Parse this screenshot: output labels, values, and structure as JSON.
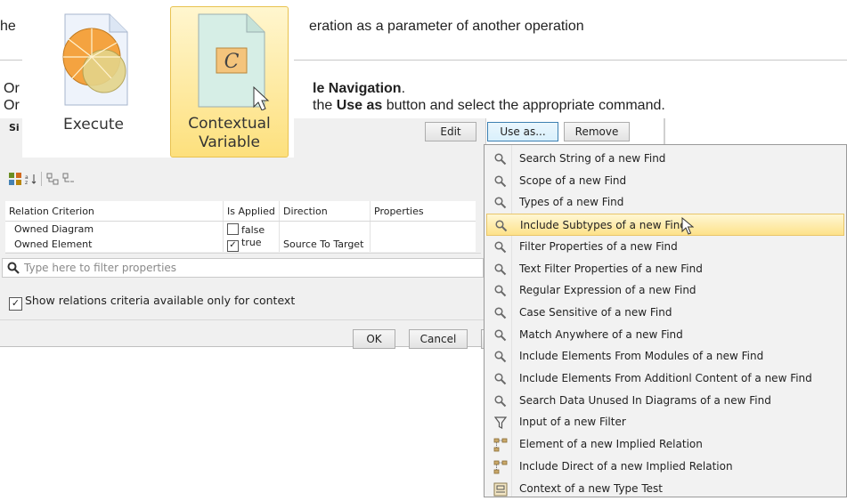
{
  "doc": {
    "line1_a": "he",
    "line1_b": "eration as a parameter of another operation",
    "line2_a": "Or",
    "line2_b": "le Navigation",
    "line2_c": ".",
    "line3_a": "Or",
    "line3_b": "the ",
    "line3_c": "Use as",
    "line3_d": " button and select the appropriate command."
  },
  "big_icons": [
    {
      "label": "Execute",
      "icon": "execute-icon"
    },
    {
      "label_line1": "Contextual",
      "label_line2": "Variable",
      "icon": "contextual-variable-icon",
      "glyph": "C"
    }
  ],
  "dialog": {
    "title_fragment": "Si",
    "buttons": {
      "edit": "Edit",
      "use_as": "Use as...",
      "remove": "Remove",
      "ok": "OK",
      "cancel": "Cancel"
    },
    "table": {
      "headers": [
        "Relation Criterion",
        "Is Applied",
        "Direction",
        "Properties"
      ],
      "rows": [
        {
          "criterion": "Owned Diagram",
          "applied": "false",
          "checked": false,
          "direction": "",
          "properties": ""
        },
        {
          "criterion": "Owned Element",
          "applied": "true",
          "checked": true,
          "direction": "Source To Target",
          "properties": ""
        }
      ]
    },
    "filter_placeholder": "Type here to filter properties",
    "show_relations_label": "Show relations criteria available only for context",
    "show_relations_checked": true
  },
  "menu": {
    "items": [
      {
        "label": "Search String of a new Find",
        "icon": "search-icon"
      },
      {
        "label": "Scope of a new Find",
        "icon": "search-icon"
      },
      {
        "label": "Types of a new Find",
        "icon": "search-icon"
      },
      {
        "label": "Include Subtypes of a new Find",
        "icon": "search-icon",
        "highlighted": true
      },
      {
        "label": "Filter Properties of a new Find",
        "icon": "search-icon"
      },
      {
        "label": "Text Filter Properties of a new Find",
        "icon": "search-icon"
      },
      {
        "label": "Regular Expression of a new Find",
        "icon": "search-icon"
      },
      {
        "label": "Case Sensitive of a new Find",
        "icon": "search-icon"
      },
      {
        "label": "Match Anywhere of a new Find",
        "icon": "search-icon"
      },
      {
        "label": "Include Elements From Modules of a new Find",
        "icon": "search-icon"
      },
      {
        "label": "Include Elements From Additionl Content of a new Find",
        "icon": "search-icon"
      },
      {
        "label": "Search Data Unused In Diagrams of a new Find",
        "icon": "search-icon"
      },
      {
        "label": "Input of a new Filter",
        "icon": "filter-icon"
      },
      {
        "label": "Element of a new Implied Relation",
        "icon": "implied-relation-icon"
      },
      {
        "label": "Include Direct of a new Implied Relation",
        "icon": "implied-relation-icon"
      },
      {
        "label": "Context of a new Type Test",
        "icon": "type-test-icon"
      }
    ]
  }
}
